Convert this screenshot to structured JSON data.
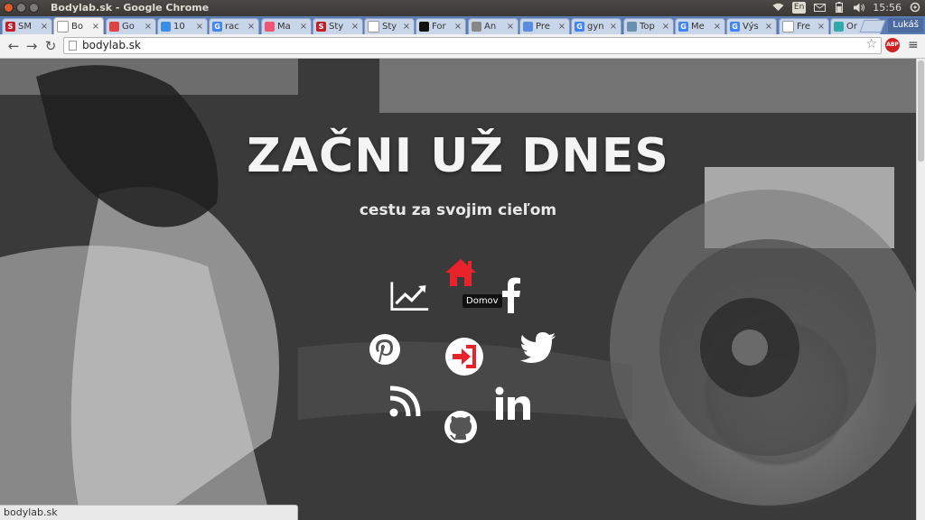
{
  "window": {
    "title": "Bodylab.sk - Google Chrome"
  },
  "tray": {
    "lang": "En",
    "time": "15:56"
  },
  "tabs": [
    {
      "label": "SM",
      "fav_color": "#c0202a",
      "fav_text": "S"
    },
    {
      "label": "Bo",
      "fav_color": "#ffffff",
      "fav_text": ""
    },
    {
      "label": "Go",
      "fav_color": "#d44",
      "fav_text": ""
    },
    {
      "label": "10",
      "fav_color": "#3a8ee6",
      "fav_text": ""
    },
    {
      "label": "rac",
      "fav_color": "#4285f4",
      "fav_text": "G"
    },
    {
      "label": "Ma",
      "fav_color": "#e57",
      "fav_text": ""
    },
    {
      "label": "Sty",
      "fav_color": "#c0202a",
      "fav_text": "S"
    },
    {
      "label": "Sty",
      "fav_color": "#ffffff",
      "fav_text": ""
    },
    {
      "label": "For",
      "fav_color": "#111",
      "fav_text": ""
    },
    {
      "label": "An",
      "fav_color": "#888",
      "fav_text": ""
    },
    {
      "label": "Pre",
      "fav_color": "#5a8de0",
      "fav_text": ""
    },
    {
      "label": "gyn",
      "fav_color": "#4285f4",
      "fav_text": "G"
    },
    {
      "label": "Top",
      "fav_color": "#6a8fb0",
      "fav_text": ""
    },
    {
      "label": "Me",
      "fav_color": "#4285f4",
      "fav_text": "G"
    },
    {
      "label": "Výs",
      "fav_color": "#4285f4",
      "fav_text": "G"
    },
    {
      "label": "Fre",
      "fav_color": "#ffffff",
      "fav_text": ""
    },
    {
      "label": "Or",
      "fav_color": "#3aa",
      "fav_text": ""
    }
  ],
  "profile": "Lukáš",
  "toolbar": {
    "url": "bodylab.sk",
    "abp": "ABP"
  },
  "hero": {
    "title": "ZAČNI UŽ DNES",
    "subtitle": "cestu za svojim cieľom"
  },
  "nav": {
    "tooltip": "Domov",
    "home_color": "#e8232b",
    "login_color": "#e8232b",
    "items": [
      "home-icon",
      "facebook-icon",
      "stats-chart-icon",
      "pinterest-icon",
      "login-icon",
      "twitter-icon",
      "rss-icon",
      "linkedin-icon",
      "github-icon"
    ]
  },
  "status": {
    "text": "bodylab.sk"
  }
}
